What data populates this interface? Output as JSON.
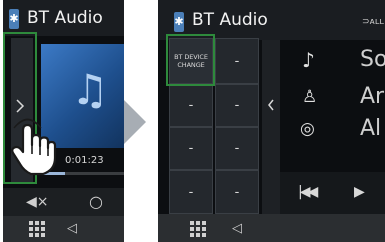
{
  "left_screen": {
    "title": "BT Audio",
    "time": "0:01:23"
  },
  "right_screen": {
    "title": "BT Audio",
    "bt_device_change_line1": "BT DEVICE",
    "bt_device_change_line2": "CHANGE",
    "preset_buttons": [
      "-",
      "-",
      "-",
      "-",
      "-",
      "-",
      "-",
      "-",
      "-"
    ],
    "song_fragment": "So",
    "artist_fragment": "Ar",
    "album_fragment": "Al"
  },
  "colors": {
    "highlight": "#2e8a3c",
    "screen_bg": "#0c0e11",
    "album_blue": "#3c7ac6"
  },
  "icons": [
    "bluetooth-icon",
    "music-note-icon",
    "mute-icon",
    "search-icon",
    "grid-menu-icon",
    "back-icon",
    "hand-tap-icon",
    "person-icon",
    "disc-icon",
    "previous-track-icon",
    "play-icon"
  ]
}
